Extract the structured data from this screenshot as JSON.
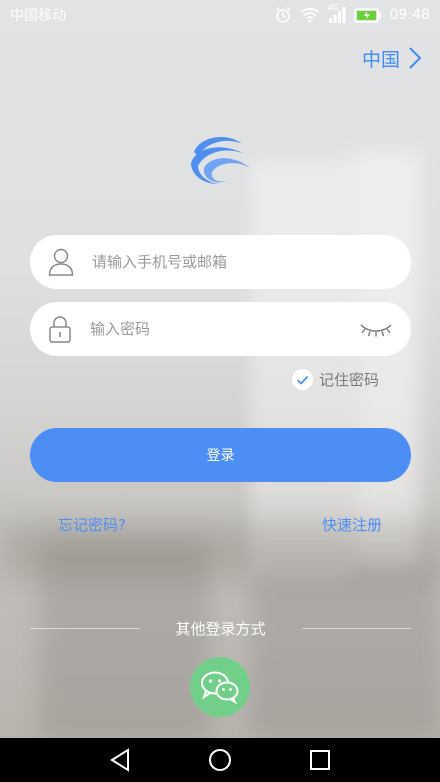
{
  "status_bar": {
    "carrier": "中国移动",
    "network": "4G",
    "time": "09:48"
  },
  "region": {
    "label": "中国",
    "icon": "chevron-right-icon"
  },
  "login_form": {
    "username_placeholder": "请输入手机号或邮箱",
    "username_value": "",
    "password_placeholder": "输入密码",
    "password_value": "",
    "remember_label": "记住密码",
    "remember_checked": true,
    "login_button": "登录"
  },
  "links": {
    "forgot": "忘记密码?",
    "register": "快速注册"
  },
  "other_login": {
    "label": "其他登录方式",
    "wechat_icon": "wechat-icon"
  },
  "colors": {
    "accent": "#4d8ef5",
    "region_text": "#3f8cf2",
    "wechat": "#72cf8a",
    "battery": "#6bd03a"
  }
}
